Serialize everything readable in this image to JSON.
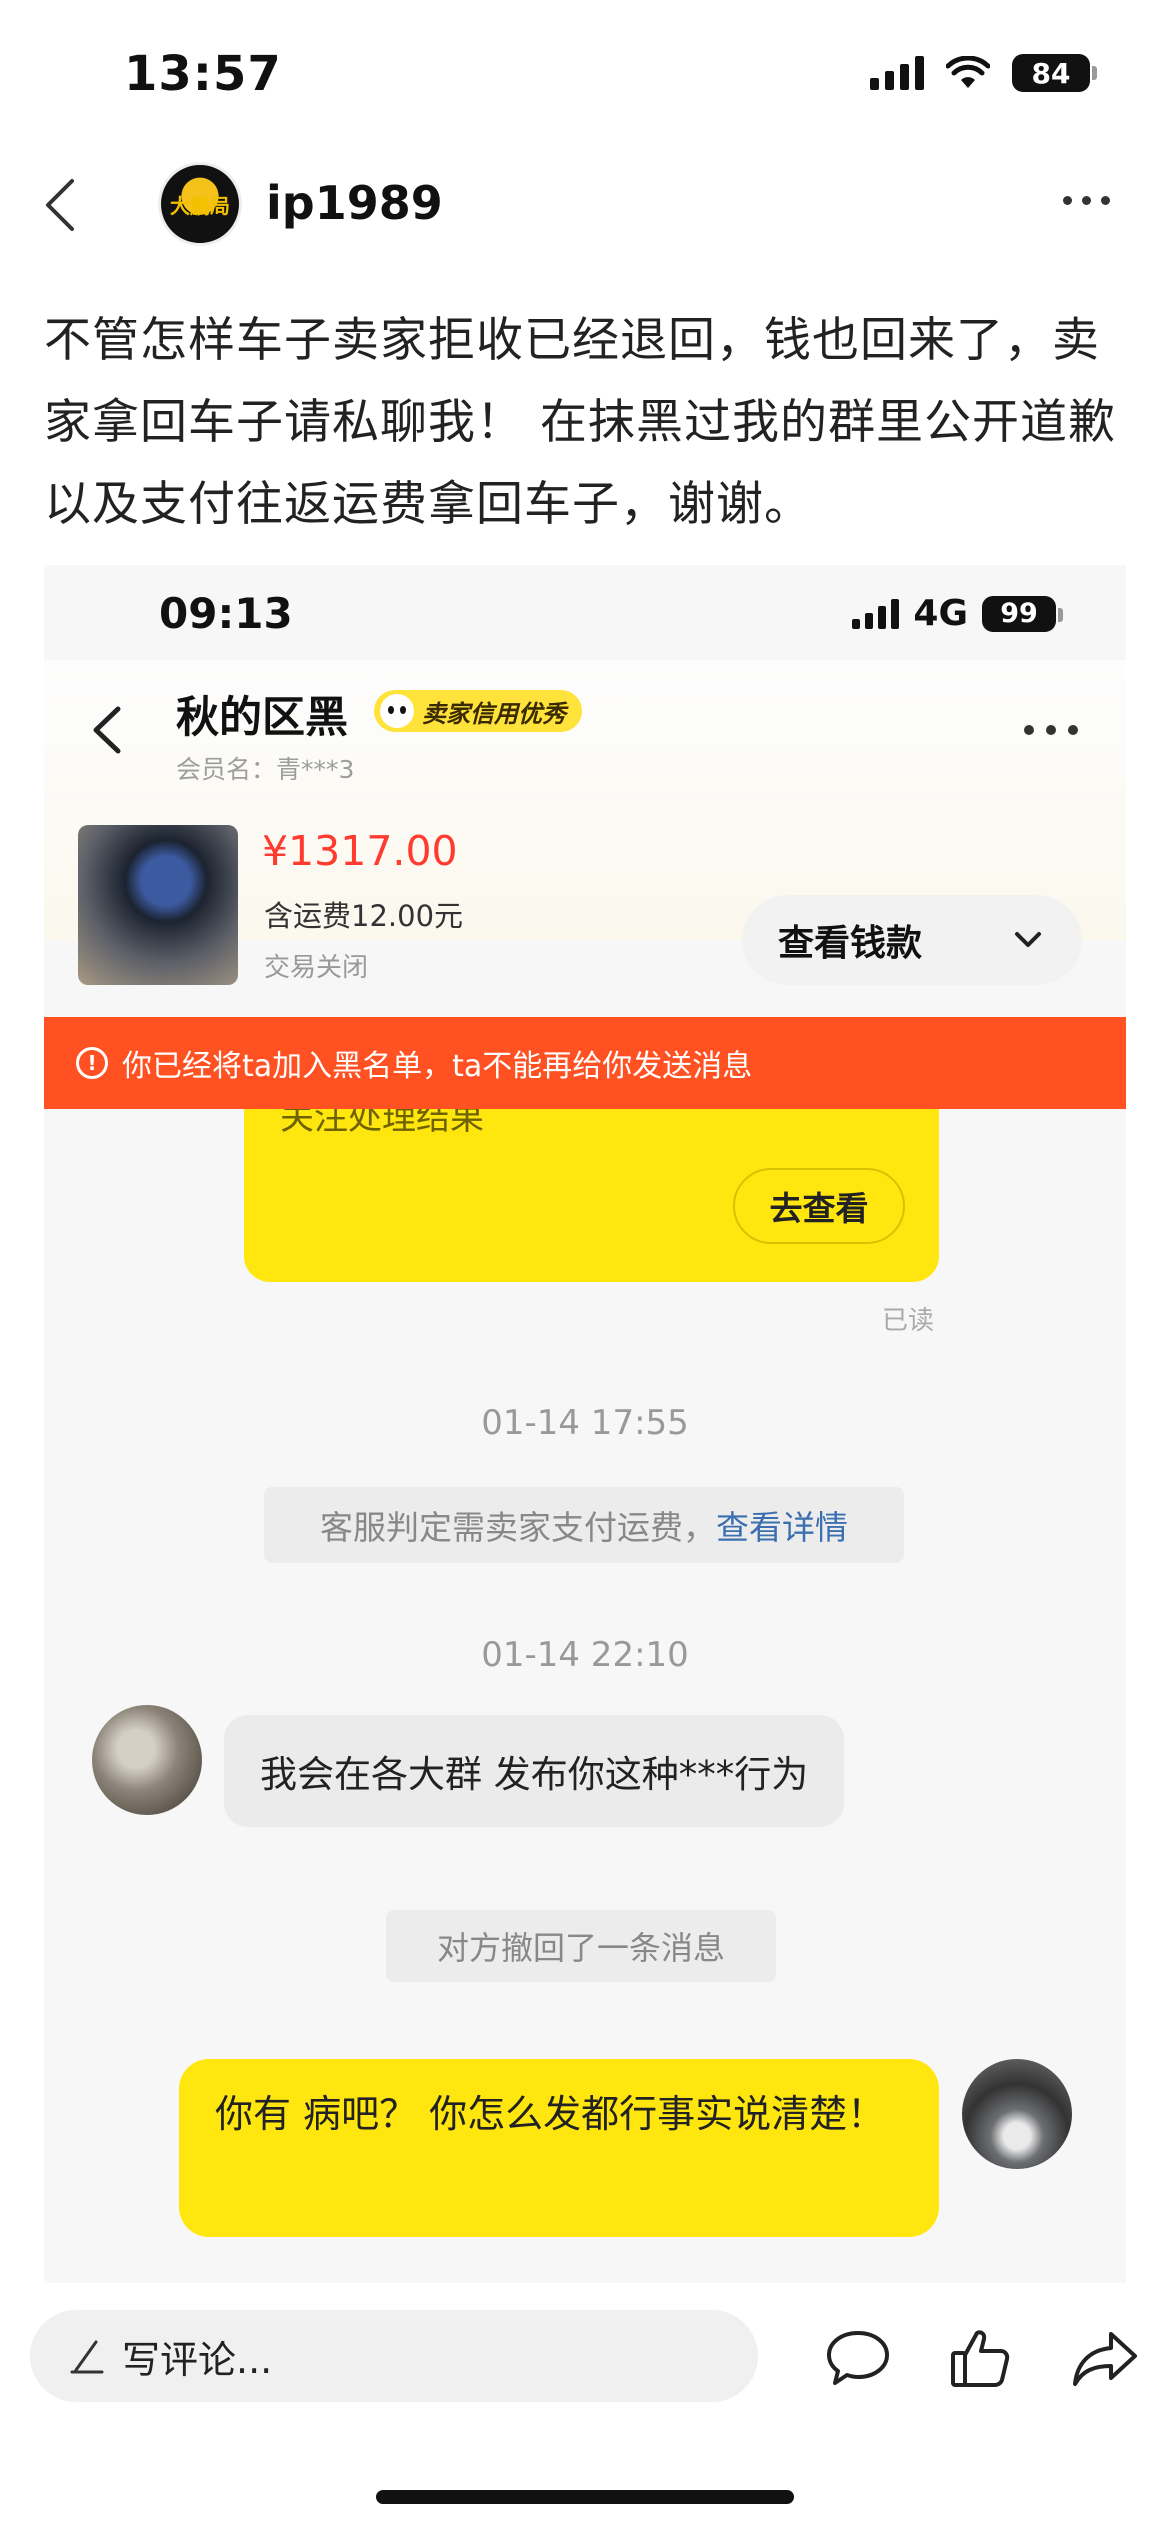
{
  "status_bar": {
    "time": "13:57",
    "battery": "84"
  },
  "post": {
    "username": "ip1989",
    "avatar_text": "大鵬局",
    "text": "不管怎样车子卖家拒收已经退回，钱也回来了，卖家拿回车子请私聊我！ 在抹黑过我的群里公开道歉以及支付往返运费拿回车子，谢谢。"
  },
  "screenshot": {
    "status_bar": {
      "time": "09:13",
      "network": "4G",
      "battery": "99"
    },
    "header": {
      "contact_name": "秋的区黑",
      "badge": "卖家信用优秀",
      "member_name": "会员名：青***3"
    },
    "product": {
      "price": "¥1317.00",
      "shipping": "含运费12.00元",
      "status": "交易关闭",
      "view_money_label": "查看钱款"
    },
    "warning": "你已经将ta加入黑名单，ta不能再给你发送消息",
    "messages": {
      "card_partial_text": "关注处理结果",
      "card_button": "去查看",
      "read_label": "已读",
      "timestamp_1": "01-14 17:55",
      "system_note": "客服判定需卖家支付运费，",
      "system_note_link": "查看详情",
      "timestamp_2": "01-14 22:10",
      "peer_message": "我会在各大群 发布你这种***行为",
      "recall_note": "对方撤回了一条消息",
      "my_message": "你有 病吧？ 你怎么发都行事实说清楚！"
    }
  },
  "bottom_bar": {
    "comment_placeholder": "写评论..."
  },
  "icons": [
    "back-icon",
    "more-icon",
    "chevron-down-icon",
    "warning-icon",
    "pen-icon",
    "comment-icon",
    "like-icon",
    "share-icon"
  ],
  "colors": {
    "accent_yellow": "#ffe60f",
    "warning_red": "#ff5122",
    "price_red": "#ff3b30",
    "link_blue": "#3b6fb0"
  }
}
